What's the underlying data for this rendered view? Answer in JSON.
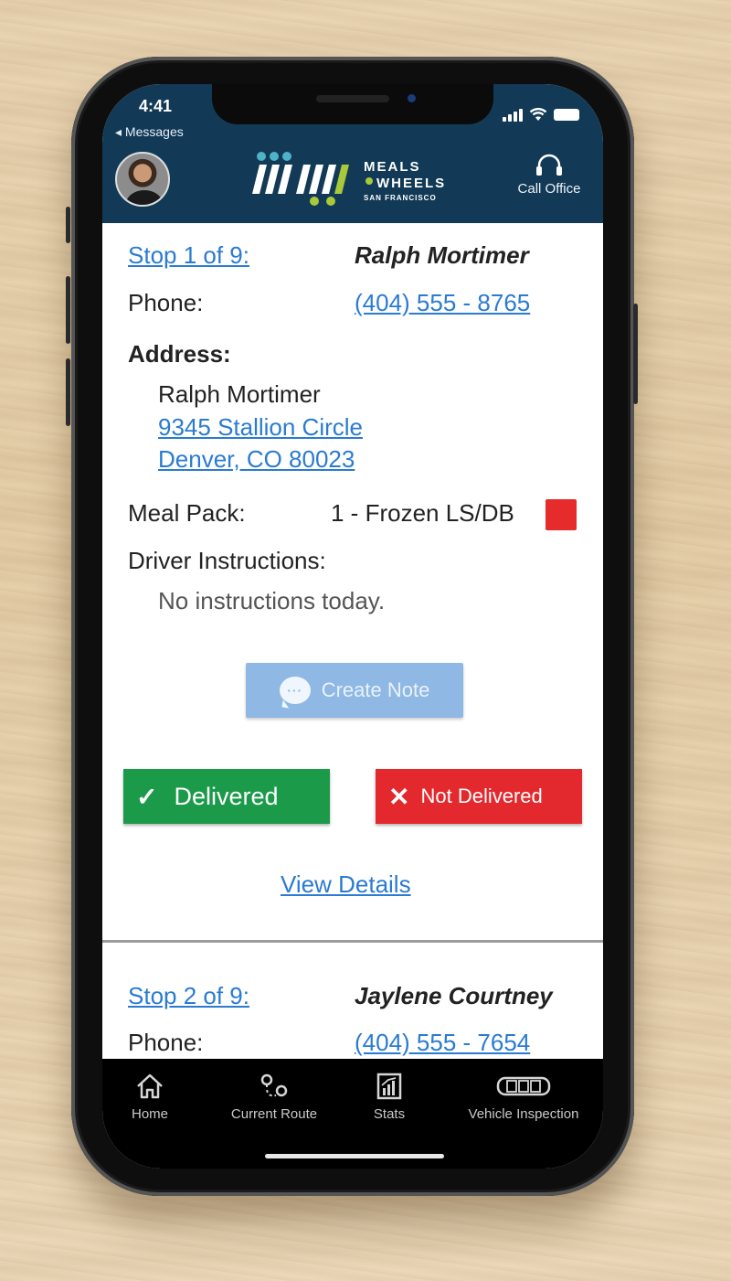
{
  "status_bar": {
    "time": "4:41",
    "back_label": "◂ Messages"
  },
  "header": {
    "logo": {
      "line1": "MEALS",
      "line2": "WHEELS",
      "line3": "SAN FRANCISCO"
    },
    "call_office_label": "Call Office"
  },
  "stops": [
    {
      "stop_label": "Stop 1 of 9:",
      "client_name": "Ralph Mortimer",
      "phone_label": "Phone:",
      "phone": "(404) 555 - 8765",
      "address_label": "Address:",
      "address_name": "Ralph Mortimer",
      "address_line1": "9345 Stallion Circle",
      "address_line2": "Denver, CO 80023",
      "meal_pack_label": "Meal Pack:",
      "meal_pack_value": "1 - Frozen LS/DB",
      "meal_pack_color": "#e52b2b",
      "instructions_label": "Driver Instructions:",
      "instructions": "No instructions today.",
      "create_note_label": "Create Note",
      "delivered_label": "Delivered",
      "not_delivered_label": "Not Delivered",
      "view_details_label": "View Details"
    },
    {
      "stop_label": "Stop 2 of 9:",
      "client_name": "Jaylene Courtney",
      "phone_label": "Phone:",
      "phone": "(404) 555 - 7654"
    }
  ],
  "tabbar": [
    {
      "label": "Home",
      "icon": "home-icon"
    },
    {
      "label": "Current Route",
      "icon": "route-icon"
    },
    {
      "label": "Stats",
      "icon": "stats-icon"
    },
    {
      "label": "Vehicle Inspection",
      "icon": "vehicle-icon"
    }
  ],
  "colors": {
    "header_bg": "#123a56",
    "link": "#2a7bd1",
    "delivered": "#1b9a4a",
    "not_delivered": "#e3292e",
    "create_note": "#8fb8e4"
  }
}
